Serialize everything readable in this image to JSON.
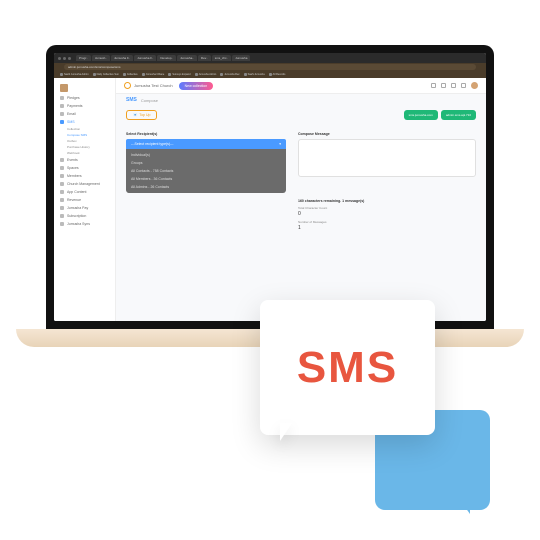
{
  "browser": {
    "url": "admin.jumusha.com/sms/compose/sms",
    "tabs": [
      "Progr..",
      "Jumush..",
      "Jumusha F..",
      "Jumusha F..",
      "Develop..",
      "Jumusha..",
      "Rev..",
      "sms_chc..",
      "Jumusha"
    ],
    "bookmarks": [
      "SaaS Jumusha Admin",
      "Daily Collective Sun",
      "Collective",
      "Jomusha CRane",
      "Surveys Expand",
      "Jumusha Admin",
      "Jumusha Rec",
      "SaaS Jumusha",
      "All Records"
    ]
  },
  "topbar": {
    "title": "Jumusha Test Church",
    "pill": "New collection"
  },
  "sidebar": {
    "items": [
      {
        "label": "Pledges"
      },
      {
        "label": "Payments"
      },
      {
        "label": "Email"
      },
      {
        "label": "SMS",
        "active": true,
        "subs": [
          {
            "label": "Collection"
          },
          {
            "label": "Compose SMS",
            "active": true
          },
          {
            "label": "Outbox"
          },
          {
            "label": "Purchase History"
          },
          {
            "label": "Webhook"
          }
        ]
      },
      {
        "label": "Events"
      },
      {
        "label": "Spaces"
      },
      {
        "label": "Members"
      },
      {
        "label": "Church Management"
      },
      {
        "label": "App Content"
      },
      {
        "label": "Revenue"
      },
      {
        "label": "Jumusha Pay"
      },
      {
        "label": "Subscription"
      },
      {
        "label": "Jumusha Syns"
      }
    ]
  },
  "breadcrumb": {
    "main": "SMS",
    "sub": "Compose"
  },
  "topup": "Top Up",
  "greenButtons": {
    "a": "sms.jumusha.com",
    "b": "admin.sms.api.710"
  },
  "form": {
    "recipientLabel": "Select Recipient(s)",
    "messageLabel": "Compose Message",
    "dropdown": {
      "selected": "---Select recipient type(s)---",
      "options": [
        "Individual(s)",
        "Groups",
        "All Contacts - 758 Contacts",
        "All Members - 36 Contacts",
        "All Admins - 26 Contacts"
      ]
    }
  },
  "counter": {
    "header": "160 characters remaining. 1 message(s)",
    "sub1": "Total Character Count",
    "val1": "0",
    "sub2": "Number of Messages",
    "val2": "1"
  },
  "illustration": {
    "text": "SMS"
  }
}
